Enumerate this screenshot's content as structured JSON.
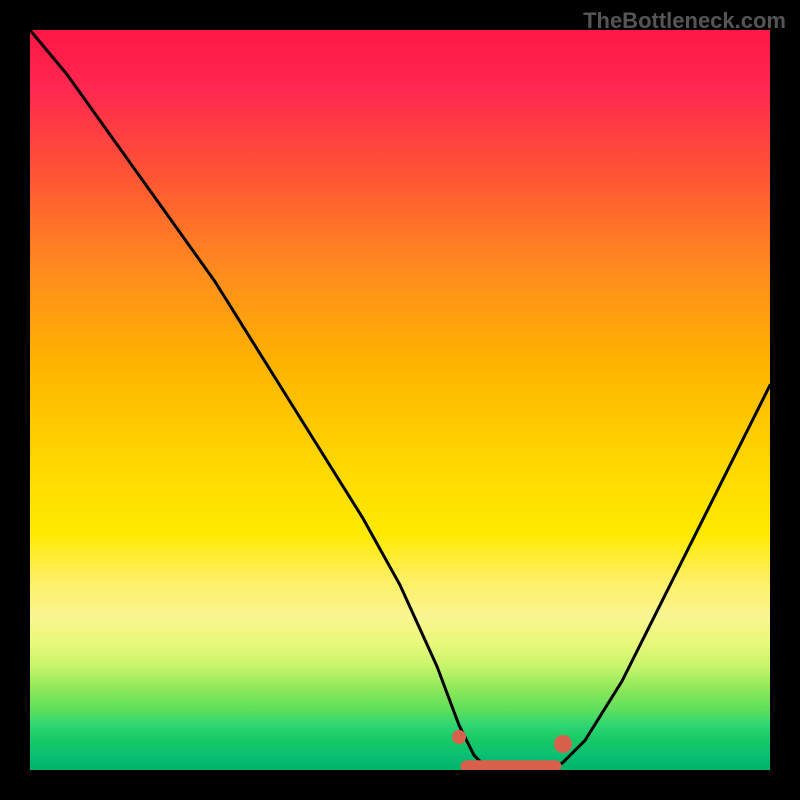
{
  "watermark": "TheBottleneck.com",
  "chart_data": {
    "type": "line",
    "title": "",
    "xlabel": "",
    "ylabel": "",
    "xlim": [
      0,
      100
    ],
    "ylim": [
      0,
      100
    ],
    "x": [
      0,
      5,
      10,
      15,
      20,
      25,
      30,
      35,
      40,
      45,
      50,
      55,
      58,
      60,
      62,
      64,
      66,
      68,
      70,
      72,
      75,
      80,
      85,
      90,
      95,
      100
    ],
    "values": [
      100,
      94,
      87,
      80,
      73,
      66,
      58,
      50,
      42,
      34,
      25,
      14,
      6,
      2,
      0,
      0,
      0,
      0,
      0,
      1,
      4,
      12,
      22,
      32,
      42,
      52
    ],
    "optimal_range_x": [
      58,
      72
    ],
    "markers": [
      {
        "x": 58,
        "y": 4.5,
        "r": 7
      },
      {
        "x": 72,
        "y": 3.5,
        "r": 9
      }
    ],
    "gradient_stops": [
      {
        "pct": 0,
        "color": "#ff1744"
      },
      {
        "pct": 45,
        "color": "#ffd600"
      },
      {
        "pct": 80,
        "color": "#f6f56a"
      },
      {
        "pct": 100,
        "color": "#00b366"
      }
    ]
  }
}
